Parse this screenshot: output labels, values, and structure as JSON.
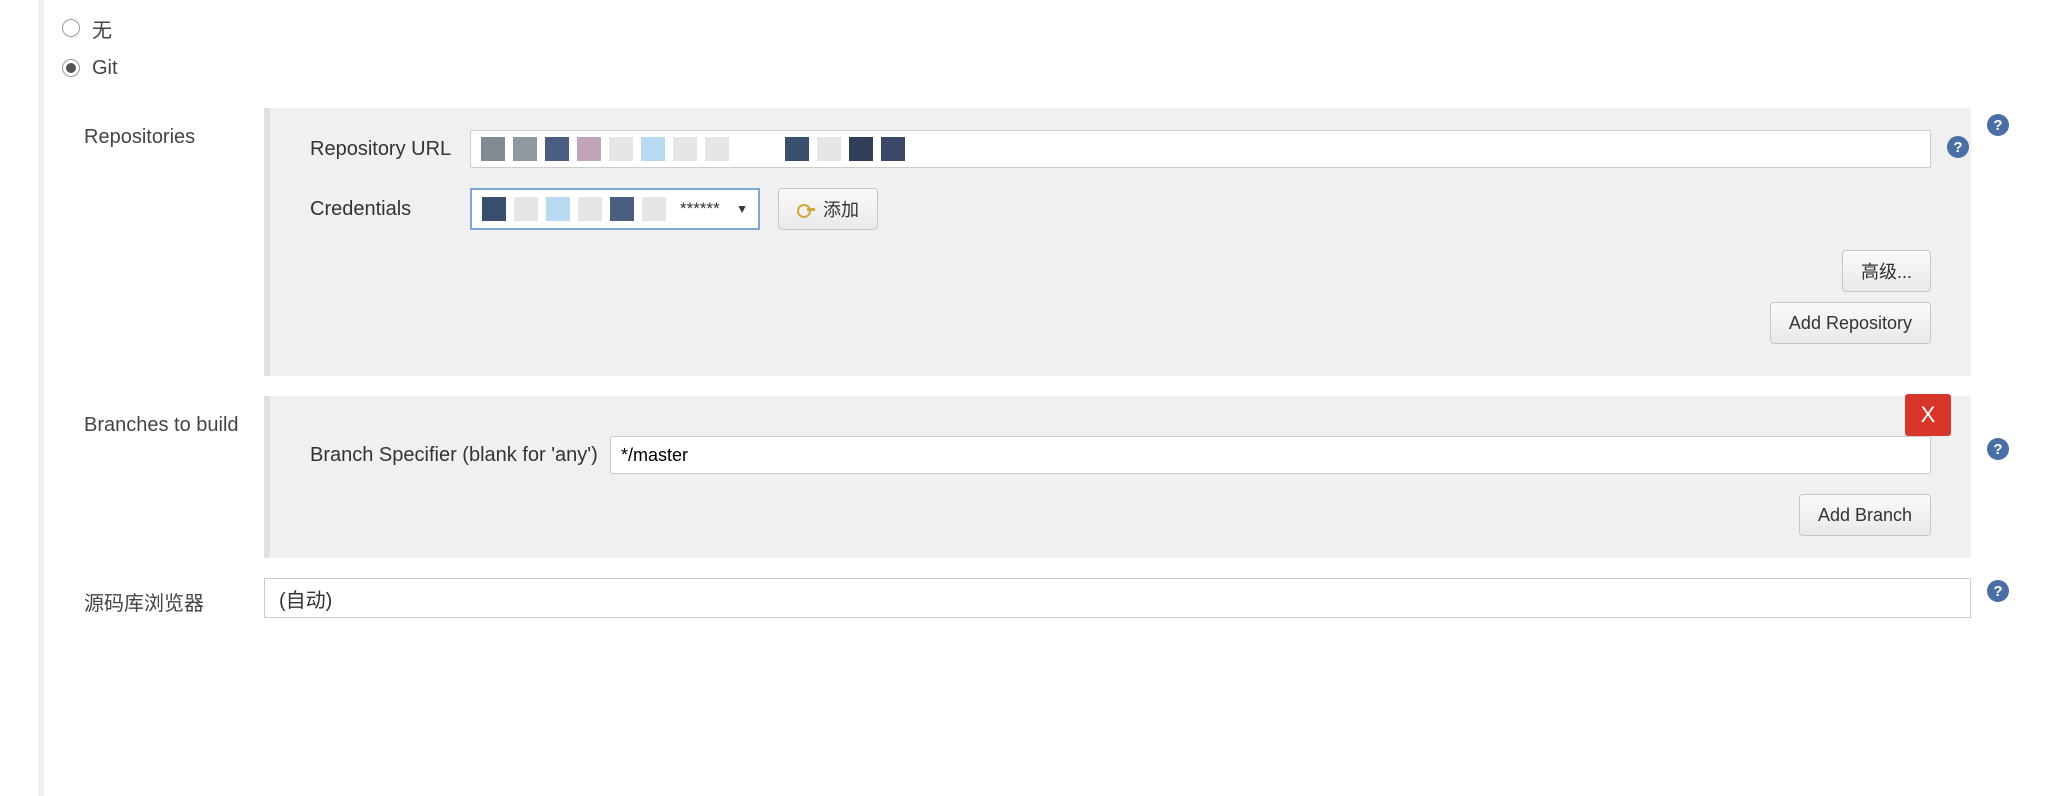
{
  "scm": {
    "option_none": "无",
    "option_git": "Git"
  },
  "repositories": {
    "section_label": "Repositories",
    "url_label": "Repository URL",
    "url_value": "",
    "credentials_label": "Credentials",
    "credentials_value": "******",
    "add_label": "添加",
    "advanced_label": "高级...",
    "add_repo_label": "Add Repository"
  },
  "branches": {
    "section_label": "Branches to build",
    "specifier_label": "Branch Specifier (blank for 'any')",
    "specifier_value": "*/master",
    "add_branch_label": "Add Branch",
    "close_label": "X"
  },
  "browser": {
    "section_label": "源码库浏览器",
    "value": "(自动)"
  },
  "help_glyph": "?",
  "watermark": ""
}
